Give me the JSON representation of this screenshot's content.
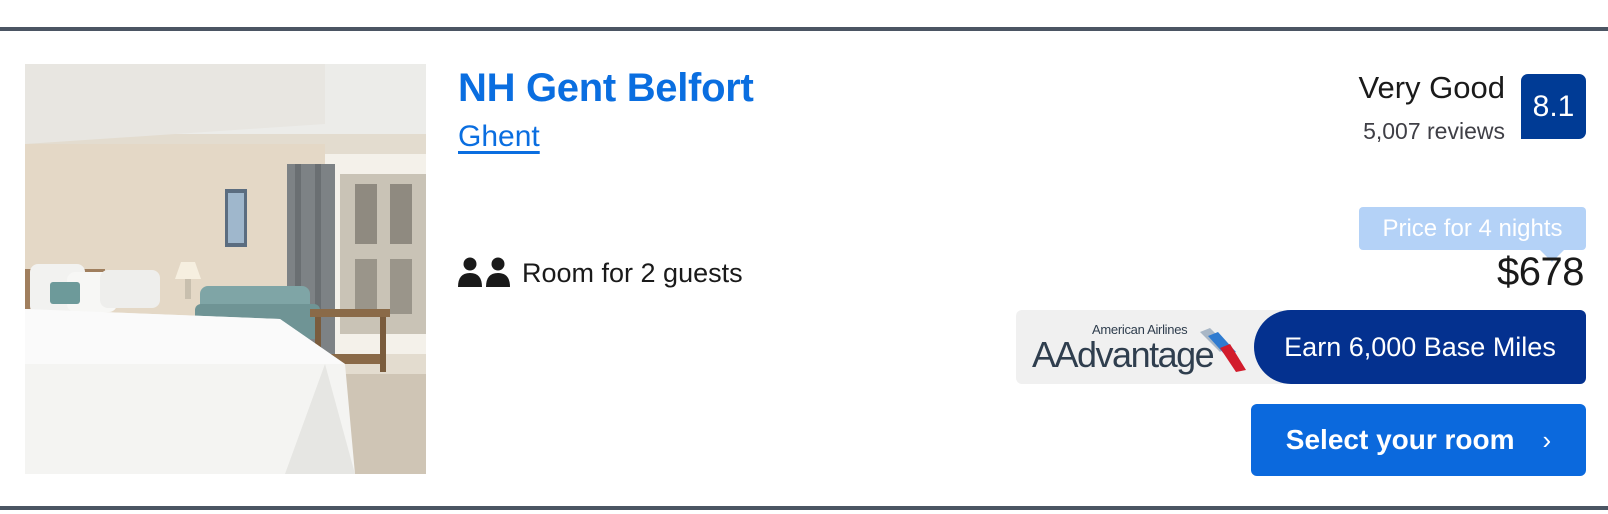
{
  "hotel": {
    "name": "NH Gent Belfort",
    "city": "Ghent",
    "occupancy": "Room for 2 guests"
  },
  "rating": {
    "label": "Very Good",
    "reviews": "5,007 reviews",
    "score": "8.1"
  },
  "price": {
    "tag": "Price for 4 nights",
    "amount": "$678"
  },
  "loyalty": {
    "logo_small": "American Airlines",
    "logo_big": "AAdvantage",
    "earn": "Earn 6,000 Base Miles"
  },
  "cta": {
    "select_label": "Select your room",
    "chevron": "›"
  },
  "icons": {
    "guests": "people-icon",
    "select": "chevron-right-icon",
    "loyalty": "american-airlines-flight-symbol-icon"
  },
  "colors": {
    "link": "#0a6ee0",
    "score_bg": "#003b95",
    "cta_bg": "#0b69dd",
    "aa_earn_bg": "#04318f",
    "price_tag_bg": "#b4d2f7"
  }
}
